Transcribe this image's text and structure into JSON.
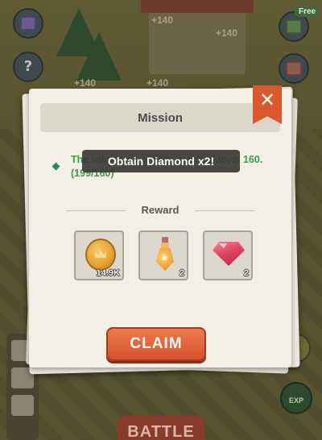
{
  "background": {
    "floating_texts": [
      "+140",
      "+140",
      "+140",
      "+140"
    ],
    "free_tag": "Free",
    "battle_label": "BATTLE",
    "exp_label": "EXP",
    "help_glyph": "?"
  },
  "modal": {
    "title": "Mission",
    "close_glyph": "✕",
    "mission_text": "The total level of pets reached level 160. (199/160)",
    "toast": "Obtain Diamond x2!",
    "reward_title": "Reward",
    "rewards": [
      {
        "icon": "gold-coin-icon",
        "quantity": "14.9K"
      },
      {
        "icon": "potion-icon",
        "quantity": "2"
      },
      {
        "icon": "diamond-icon",
        "quantity": "2"
      }
    ],
    "claim_label": "CLAIM"
  },
  "colors": {
    "accent": "#d9592c",
    "mission_text": "#3d9a48",
    "modal_bg": "#f2efe4"
  }
}
